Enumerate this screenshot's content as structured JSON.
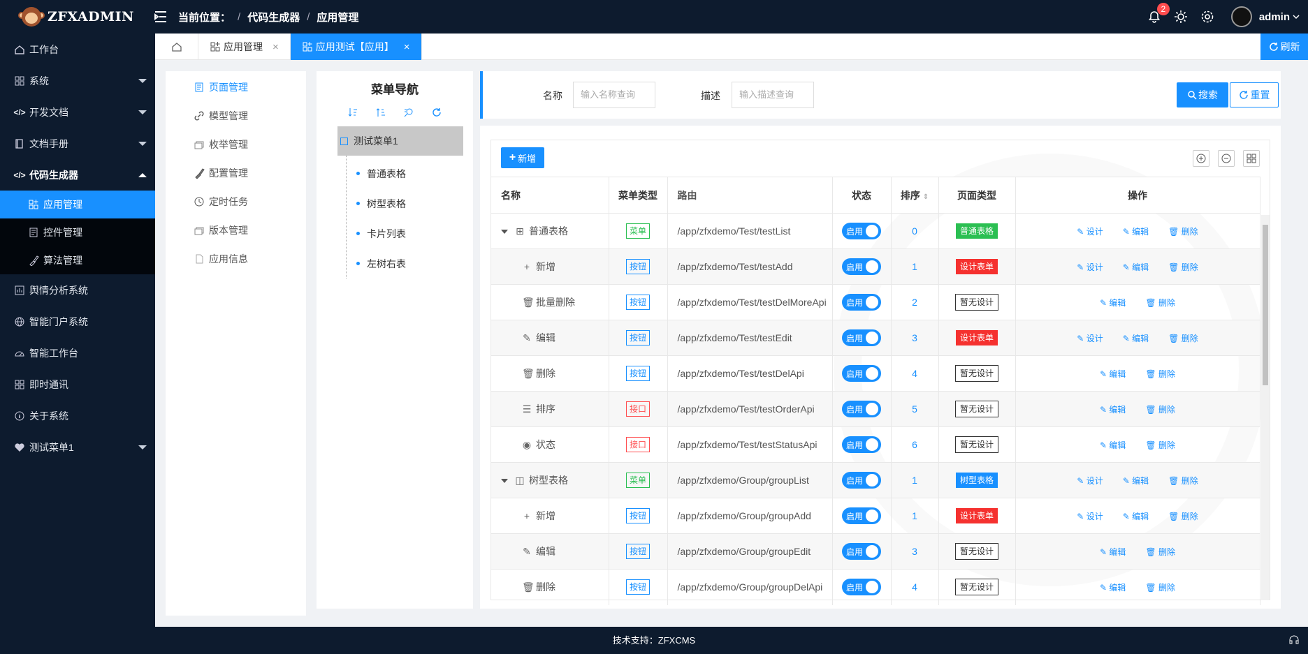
{
  "header": {
    "brand": "ZFXADMIN",
    "breadcrumb_prefix": "当前位置：",
    "breadcrumb": [
      "代码生成器",
      "应用管理"
    ],
    "notification_count": "2",
    "username": "admin"
  },
  "sidebar": {
    "items": [
      {
        "label": "工作台",
        "icon": "home-icon"
      },
      {
        "label": "系统",
        "icon": "grid-icon"
      },
      {
        "label": "开发文档",
        "icon": "code-icon"
      },
      {
        "label": "文档手册",
        "icon": "book-icon"
      },
      {
        "label": "代码生成器",
        "icon": "code-icon"
      },
      {
        "label": "舆情分析系统",
        "icon": "chart-icon"
      },
      {
        "label": "智能门户系统",
        "icon": "globe-icon"
      },
      {
        "label": "智能工作台",
        "icon": "dashboard-icon"
      },
      {
        "label": "即时通讯",
        "icon": "grid-icon"
      },
      {
        "label": "关于系统",
        "icon": "info-icon"
      },
      {
        "label": "测试菜单1",
        "icon": "heart-icon"
      }
    ],
    "sub_items": [
      {
        "label": "应用管理"
      },
      {
        "label": "控件管理"
      },
      {
        "label": "算法管理"
      }
    ]
  },
  "tabs": {
    "items": [
      {
        "label": "应用管理"
      },
      {
        "label": "应用测试【应用】"
      }
    ],
    "refresh_label": "刷新"
  },
  "pagenav": {
    "items": [
      {
        "label": "页面管理"
      },
      {
        "label": "模型管理"
      },
      {
        "label": "枚举管理"
      },
      {
        "label": "配置管理"
      },
      {
        "label": "定时任务"
      },
      {
        "label": "版本管理"
      },
      {
        "label": "应用信息"
      }
    ]
  },
  "tree": {
    "title": "菜单导航",
    "root": "测试菜单1",
    "children": [
      "普通表格",
      "树型表格",
      "卡片列表",
      "左树右表"
    ]
  },
  "search": {
    "name_label": "名称",
    "name_placeholder": "输入名称查询",
    "desc_label": "描述",
    "desc_placeholder": "输入描述查询",
    "search_button": "搜索",
    "reset_button": "重置"
  },
  "table": {
    "add_button": "新增",
    "columns": [
      "名称",
      "菜单类型",
      "路由",
      "状态",
      "排序",
      "页面类型",
      "操作"
    ],
    "status_label": "启用",
    "actions": {
      "design": "设计",
      "edit": "编辑",
      "delete": "删除"
    },
    "rows": [
      {
        "name": "普通表格",
        "level": 0,
        "type": "菜单",
        "type_class": "menu",
        "route": "/app/zfxdemo/Test/testList",
        "sort": "0",
        "page_type": "普通表格",
        "page_class": "green",
        "design": true
      },
      {
        "name": "新增",
        "level": 1,
        "type": "按钮",
        "type_class": "button",
        "route": "/app/zfxdemo/Test/testAdd",
        "sort": "1",
        "page_type": "设计表单",
        "page_class": "red",
        "design": true
      },
      {
        "name": "批量删除",
        "level": 1,
        "type": "按钮",
        "type_class": "button",
        "route": "/app/zfxdemo/Test/testDelMoreApi",
        "sort": "2",
        "page_type": "暂无设计",
        "page_class": "none",
        "design": false
      },
      {
        "name": "编辑",
        "level": 1,
        "type": "按钮",
        "type_class": "button",
        "route": "/app/zfxdemo/Test/testEdit",
        "sort": "3",
        "page_type": "设计表单",
        "page_class": "red",
        "design": true
      },
      {
        "name": "删除",
        "level": 1,
        "type": "按钮",
        "type_class": "button",
        "route": "/app/zfxdemo/Test/testDelApi",
        "sort": "4",
        "page_type": "暂无设计",
        "page_class": "none",
        "design": false
      },
      {
        "name": "排序",
        "level": 1,
        "type": "接口",
        "type_class": "api",
        "route": "/app/zfxdemo/Test/testOrderApi",
        "sort": "5",
        "page_type": "暂无设计",
        "page_class": "none",
        "design": false
      },
      {
        "name": "状态",
        "level": 1,
        "type": "接口",
        "type_class": "api",
        "route": "/app/zfxdemo/Test/testStatusApi",
        "sort": "6",
        "page_type": "暂无设计",
        "page_class": "none",
        "design": false
      },
      {
        "name": "树型表格",
        "level": 0,
        "type": "菜单",
        "type_class": "menu",
        "route": "/app/zfxdemo/Group/groupList",
        "sort": "1",
        "page_type": "树型表格",
        "page_class": "blue",
        "design": true
      },
      {
        "name": "新增",
        "level": 1,
        "type": "按钮",
        "type_class": "button",
        "route": "/app/zfxdemo/Group/groupAdd",
        "sort": "1",
        "page_type": "设计表单",
        "page_class": "red",
        "design": true
      },
      {
        "name": "编辑",
        "level": 1,
        "type": "按钮",
        "type_class": "button",
        "route": "/app/zfxdemo/Group/groupEdit",
        "sort": "3",
        "page_type": "暂无设计",
        "page_class": "none",
        "design": false
      },
      {
        "name": "删除",
        "level": 1,
        "type": "按钮",
        "type_class": "button",
        "route": "/app/zfxdemo/Group/groupDelApi",
        "sort": "4",
        "page_type": "暂无设计",
        "page_class": "none",
        "design": false
      }
    ]
  },
  "footer": {
    "text": "技术支持：ZFXCMS"
  }
}
